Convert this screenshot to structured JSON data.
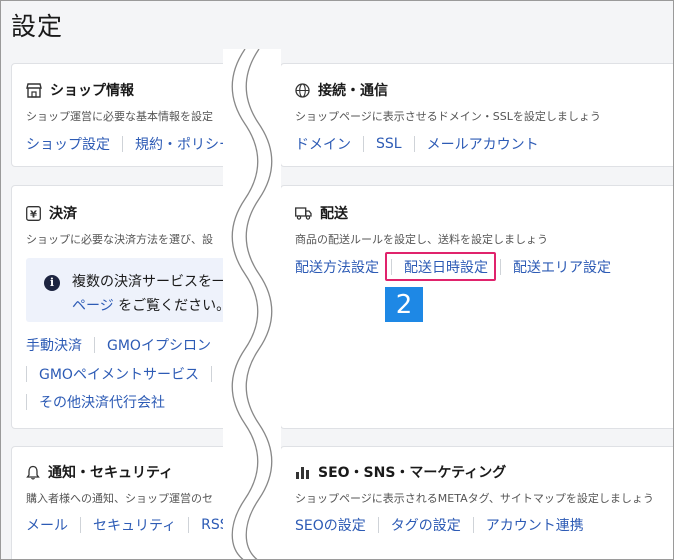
{
  "page": {
    "title": "設定"
  },
  "cards": {
    "shop": {
      "title": "ショップ情報",
      "desc": "ショップ運営に必要な基本情報を設定",
      "links": [
        "ショップ設定",
        "規約・ポリシー"
      ]
    },
    "connect": {
      "title": "接続・通信",
      "desc": "ショップページに表示させるドメイン・SSLを設定しましょう",
      "links": [
        "ドメイン",
        "SSL",
        "メールアカウント"
      ]
    },
    "payment": {
      "title": "決済",
      "desc": "ショップに必要な決済方法を選び、設",
      "info_line1": "複数の決済サービスを一",
      "info_link": "ページ",
      "info_line2_rest": " をご覧ください。",
      "links_row1": [
        "手動決済",
        "GMOイプシロン"
      ],
      "links_row2": [
        "GMOペイメントサービス",
        "ス"
      ],
      "links_row3": [
        "その他決済代行会社"
      ]
    },
    "delivery": {
      "title": "配送",
      "desc": "商品の配送ルールを設定し、送料を設定しましょう",
      "links": [
        "配送方法設定",
        "配送日時設定",
        "配送エリア設定"
      ]
    },
    "notify": {
      "title": "通知・セキュリティ",
      "desc": "購入者様への通知、ショップ運営のセ",
      "links": [
        "メール",
        "セキュリティ",
        "RSS"
      ]
    },
    "seo": {
      "title": "SEO・SNS・マーケティング",
      "desc": "ショップページに表示されるMETAタグ、サイトマップを設定しましょう",
      "links": [
        "SEOの設定",
        "タグの設定",
        "アカウント連携"
      ]
    }
  },
  "annotation": {
    "step": "2"
  },
  "colors": {
    "link": "#2d5bb5",
    "highlight": "#e0236c",
    "badge": "#1e88e5"
  }
}
